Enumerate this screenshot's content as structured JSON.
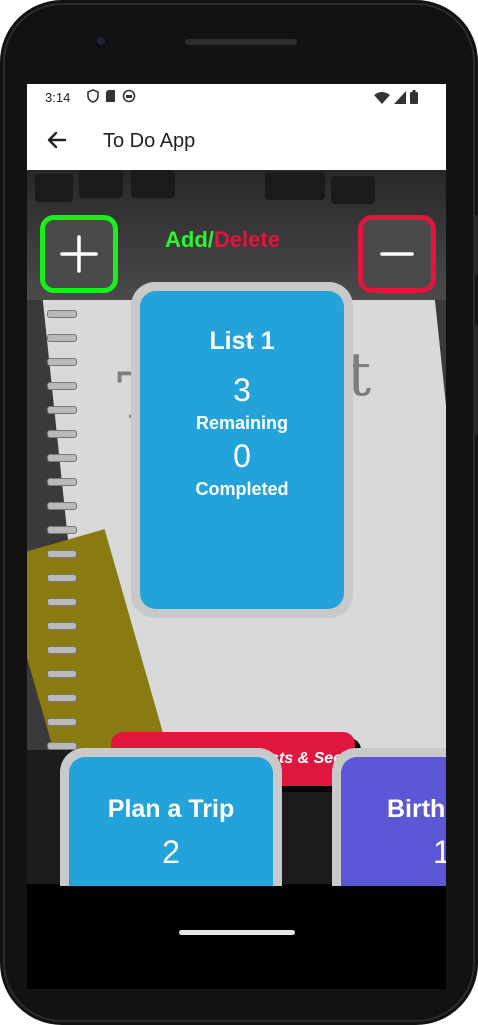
{
  "status_bar": {
    "time": "3:14",
    "left_icons": [
      "shield-icon",
      "sim-icon",
      "circle-icon"
    ],
    "right_icons": [
      "wifi-icon",
      "signal-icon",
      "battery-icon"
    ]
  },
  "app_bar": {
    "title": "To Do App",
    "back_icon": "arrow-back-icon"
  },
  "toolbar": {
    "add_label": "Add/",
    "delete_label": "Delete",
    "add_icon": "plus-icon",
    "delete_icon": "minus-icon"
  },
  "main_card": {
    "title": "List 1",
    "remaining_count": "3",
    "remaining_label": "Remaining",
    "completed_count": "0",
    "completed_label": "Completed"
  },
  "save_button": {
    "label": "Press me To Save Lists & See.."
  },
  "bottom_cards": [
    {
      "title": "Plan a Trip",
      "count": "2"
    },
    {
      "title": "Birth",
      "count": "1"
    }
  ],
  "colors": {
    "card_blue": "#23a3da",
    "card_purple": "#5b57d6",
    "add_green": "#19ef19",
    "delete_red": "#e0163f"
  }
}
